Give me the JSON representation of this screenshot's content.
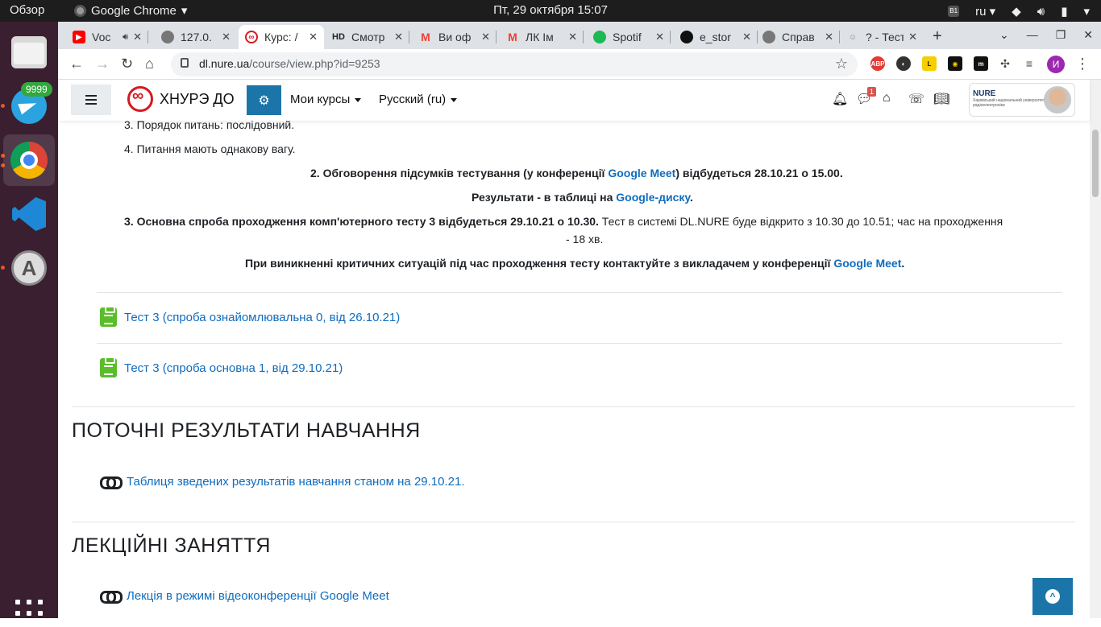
{
  "topbar": {
    "overview": "Обзор",
    "app_menu": "Google Chrome",
    "clock": "Пт, 29 октября  15:07",
    "lang": "ru"
  },
  "dock": {
    "telegram_badge": "9999"
  },
  "browser": {
    "tabs": [
      {
        "label": "Voc",
        "icon": "youtube-icon",
        "color": "#ff0000"
      },
      {
        "label": "127.0.",
        "icon": "globe-icon",
        "color": "#777777"
      },
      {
        "label": "Курс: /",
        "icon": "nure-icon",
        "color": "#d7191f"
      },
      {
        "label": "Смотр",
        "icon": "hd-icon",
        "color": "#222222"
      },
      {
        "label": "Ви оф",
        "icon": "gmail-icon",
        "color": "#ea4335"
      },
      {
        "label": "ЛК Ім",
        "icon": "gmail-icon",
        "color": "#ea4335"
      },
      {
        "label": "Spotif",
        "icon": "spotify-icon",
        "color": "#1db954"
      },
      {
        "label": "e_stor",
        "icon": "github-icon",
        "color": "#111111"
      },
      {
        "label": "Справ",
        "icon": "globe-icon",
        "color": "#777777"
      },
      {
        "label": "? - Тест",
        "icon": "mask-icon",
        "color": "#888888"
      }
    ],
    "url_host": "dl.nure.ua",
    "url_path": "/course/view.php?id=9253",
    "profile_initial": "И"
  },
  "moodle": {
    "brand": "ХНУРЭ ДО",
    "my_courses": "Мои курсы",
    "language": "Русский (ru)",
    "messages_count": "1",
    "logo_text": "NURE"
  },
  "content": {
    "item3": "3. Порядок питань: послідовний.",
    "item4": "4. Питання мають однакову вагу.",
    "p2_bold": "2. Обговорення підсумків тестування (у конференції",
    "p2_link": "Google Meet",
    "p2_tail": ") відбудеться 28.10.21 о 15.00.",
    "p_results": "Результати - в таблиці на",
    "p_results_link": "Google-диску",
    "p_results_dot": ".",
    "p3_bold": "3. Основна спроба проходження комп'ютерного тесту 3 відбудеться 29.10.21 о 10.30.",
    "p3_text": " Тест в системі DL.NURE буде відкрито з 10.30 до 10.51; час на проходження",
    "p3_text2": "- 18 хв.",
    "p_crit": "При виникненні критичних ситуацій під час проходження тесту контактуйте з викладачем у конференції",
    "p_crit_link": "Google Meet",
    "p_crit_dot": ".",
    "quiz1": "Тест 3 (спроба ознайомлювальна 0, від 26.10.21)",
    "quiz2": "Тест 3 (спроба основна 1, від 29.10.21)",
    "section1": "ПОТОЧНІ РЕЗУЛЬТАТИ НАВЧАННЯ",
    "link1": "Таблиця зведених результатів навчання станом на 29.10.21.",
    "section2": "ЛЕКЦІЙНІ ЗАНЯТТЯ",
    "link2": "Лекція в режимі відеоконференції Google Meet"
  }
}
